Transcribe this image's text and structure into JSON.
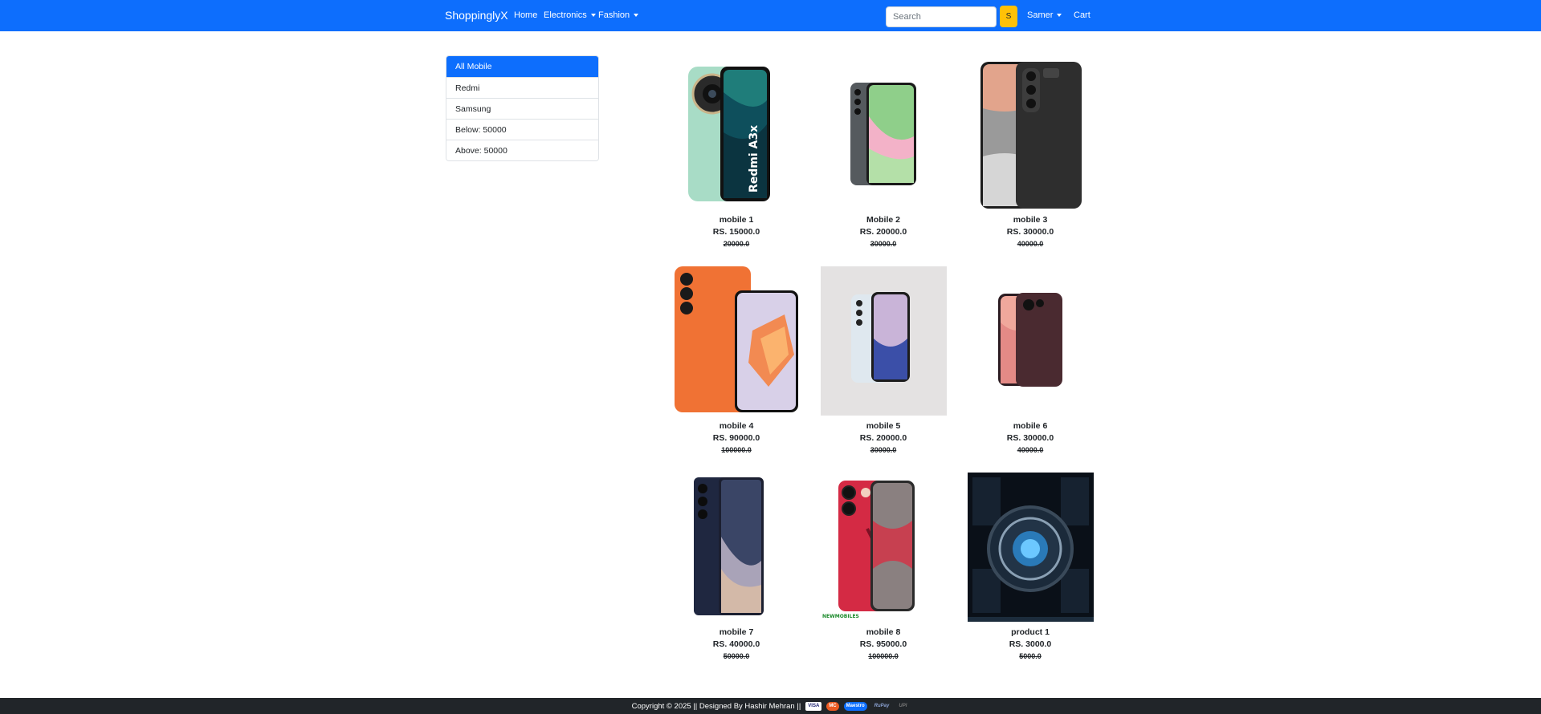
{
  "navbar": {
    "brand": "ShoppinglyX",
    "home": "Home",
    "electronics": "Electronics",
    "fashion": "Fashion",
    "search_placeholder": "Search",
    "search_button": "S",
    "user": "Samer",
    "cart": "Cart"
  },
  "sidebar": {
    "items": [
      {
        "label": "All Mobile"
      },
      {
        "label": "Redmi"
      },
      {
        "label": "Samsung"
      },
      {
        "label": "Below: 50000"
      },
      {
        "label": "Above: 50000"
      }
    ]
  },
  "products": [
    {
      "name": "mobile 1",
      "price": "RS. 15000.0",
      "old_price": "20000.0"
    },
    {
      "name": "Mobile 2",
      "price": "RS. 20000.0",
      "old_price": "30000.0"
    },
    {
      "name": "mobile 3",
      "price": "RS. 30000.0",
      "old_price": "40000.0"
    },
    {
      "name": "mobile 4",
      "price": "RS. 90000.0",
      "old_price": "100000.0"
    },
    {
      "name": "mobile 5",
      "price": "RS. 20000.0",
      "old_price": "30000.0"
    },
    {
      "name": "mobile 6",
      "price": "RS. 30000.0",
      "old_price": "40000.0"
    },
    {
      "name": "mobile 7",
      "price": "RS. 40000.0",
      "old_price": "50000.0"
    },
    {
      "name": "mobile 8",
      "price": "RS. 95000.0",
      "old_price": "100000.0"
    },
    {
      "name": "product 1",
      "price": "RS. 3000.0",
      "old_price": "5000.0"
    }
  ],
  "image_texts": {
    "redmi_label": "Redmi A3x",
    "newmobiles_watermark": "NEWMOBILES"
  },
  "footer": {
    "text": "Copyright © 2025 || Designed By Hashir Mehran ||",
    "payments": [
      "VISA",
      "MC",
      "Maestro",
      "RuPay",
      "UPI"
    ]
  },
  "colors": {
    "primary": "#0d6efd",
    "warning": "#ffc107",
    "dark": "#212529"
  }
}
